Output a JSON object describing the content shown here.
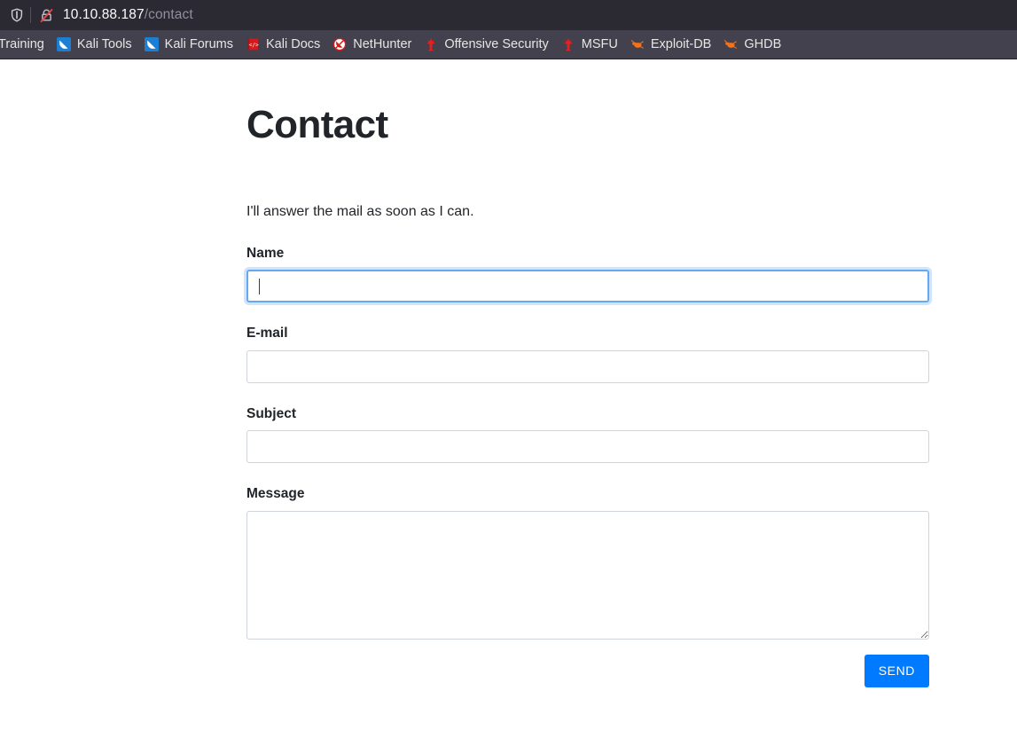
{
  "browser": {
    "url": {
      "host": "10.10.88.187",
      "path": "/contact"
    },
    "icons": {
      "shield": "shield-icon",
      "insecure_lock": "lock-crossed-icon"
    },
    "bookmarks": [
      {
        "label": "Training",
        "icon": "training-icon",
        "truncated": true
      },
      {
        "label": "Kali Tools",
        "icon": "kali-dragon-blue-icon",
        "truncated": false
      },
      {
        "label": "Kali Forums",
        "icon": "kali-dragon-blue-icon",
        "truncated": false
      },
      {
        "label": "Kali Docs",
        "icon": "kali-docs-book-icon",
        "truncated": false
      },
      {
        "label": "NetHunter",
        "icon": "nethunter-icon",
        "truncated": false
      },
      {
        "label": "Offensive Security",
        "icon": "offsec-dragon-icon",
        "truncated": false
      },
      {
        "label": "MSFU",
        "icon": "offsec-dragon-icon",
        "truncated": false
      },
      {
        "label": "Exploit-DB",
        "icon": "exploitdb-bug-icon",
        "truncated": false
      },
      {
        "label": "GHDB",
        "icon": "exploitdb-bug-icon",
        "truncated": false
      }
    ]
  },
  "page": {
    "title": "Contact",
    "intro": "I'll answer the mail as soon as I can.",
    "form": {
      "name": {
        "label": "Name",
        "value": "",
        "placeholder": "",
        "focused": true
      },
      "email": {
        "label": "E-mail",
        "value": "",
        "placeholder": "",
        "focused": false
      },
      "subject": {
        "label": "Subject",
        "value": "",
        "placeholder": "",
        "focused": false
      },
      "message": {
        "label": "Message",
        "value": "",
        "placeholder": "",
        "focused": false
      }
    },
    "submit_label": "SEND"
  },
  "colors": {
    "urlbar_bg": "#2b2a33",
    "bookmarks_bg": "#42414d",
    "page_bg": "#ffffff",
    "text_primary": "#212529",
    "accent_button": "#007bff",
    "focus_border": "#63a9f5",
    "input_border": "#ced4da"
  }
}
